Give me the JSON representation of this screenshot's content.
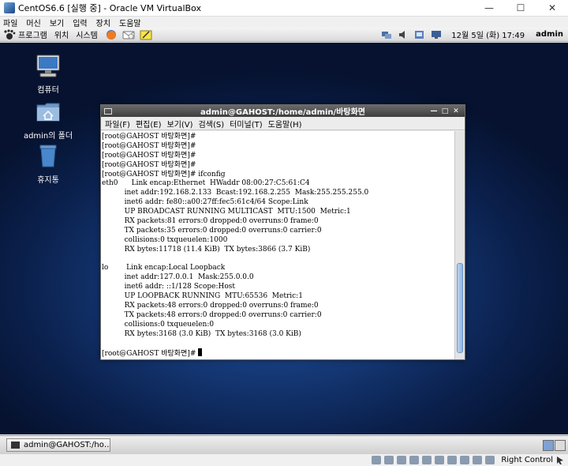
{
  "window": {
    "title": "CentOS6.6 [실행 중] - Oracle VM VirtualBox"
  },
  "host_menu": [
    "파일",
    "머신",
    "보기",
    "입력",
    "장치",
    "도움말"
  ],
  "guest_panel": {
    "menus": [
      "프로그램",
      "위치",
      "시스템"
    ],
    "clock": "12월  5일 (화)  17:49",
    "user": "admin"
  },
  "desktop_icons": [
    {
      "label": "컴퓨터",
      "icon": "computer-icon"
    },
    {
      "label": "admin의 폴더",
      "icon": "home-folder-icon"
    },
    {
      "label": "휴지통",
      "icon": "trash-icon"
    }
  ],
  "terminal": {
    "title": "admin@GAHOST:/home/admin/바탕화면",
    "menus": [
      "파일(F)",
      "편집(E)",
      "보기(V)",
      "검색(S)",
      "터미널(T)",
      "도움말(H)"
    ],
    "lines": [
      "[root@GAHOST 바탕화면]#",
      "[root@GAHOST 바탕화면]#",
      "[root@GAHOST 바탕화면]#",
      "[root@GAHOST 바탕화면]#",
      "[root@GAHOST 바탕화면]# ifconfig",
      "eth0      Link encap:Ethernet  HWaddr 08:00:27:C5:61:C4",
      "          inet addr:192.168.2.133  Bcast:192.168.2.255  Mask:255.255.255.0",
      "          inet6 addr: fe80::a00:27ff:fec5:61c4/64 Scope:Link",
      "          UP BROADCAST RUNNING MULTICAST  MTU:1500  Metric:1",
      "          RX packets:81 errors:0 dropped:0 overruns:0 frame:0",
      "          TX packets:35 errors:0 dropped:0 overruns:0 carrier:0",
      "          collisions:0 txqueuelen:1000",
      "          RX bytes:11718 (11.4 KiB)  TX bytes:3866 (3.7 KiB)",
      "",
      "lo        Link encap:Local Loopback",
      "          inet addr:127.0.0.1  Mask:255.0.0.0",
      "          inet6 addr: ::1/128 Scope:Host",
      "          UP LOOPBACK RUNNING  MTU:65536  Metric:1",
      "          RX packets:48 errors:0 dropped:0 overruns:0 frame:0",
      "          TX packets:48 errors:0 dropped:0 overruns:0 carrier:0",
      "          collisions:0 txqueuelen:0",
      "          RX bytes:3168 (3.0 KiB)  TX bytes:3168 (3.0 KiB)",
      "",
      "[root@GAHOST 바탕화면]# "
    ]
  },
  "taskbar": {
    "item": "admin@GAHOST:/ho…"
  },
  "statusbar": {
    "host_key": "Right Control"
  },
  "colors": {
    "accent": "#153977",
    "scroll_thumb": "#8fb5e3"
  }
}
